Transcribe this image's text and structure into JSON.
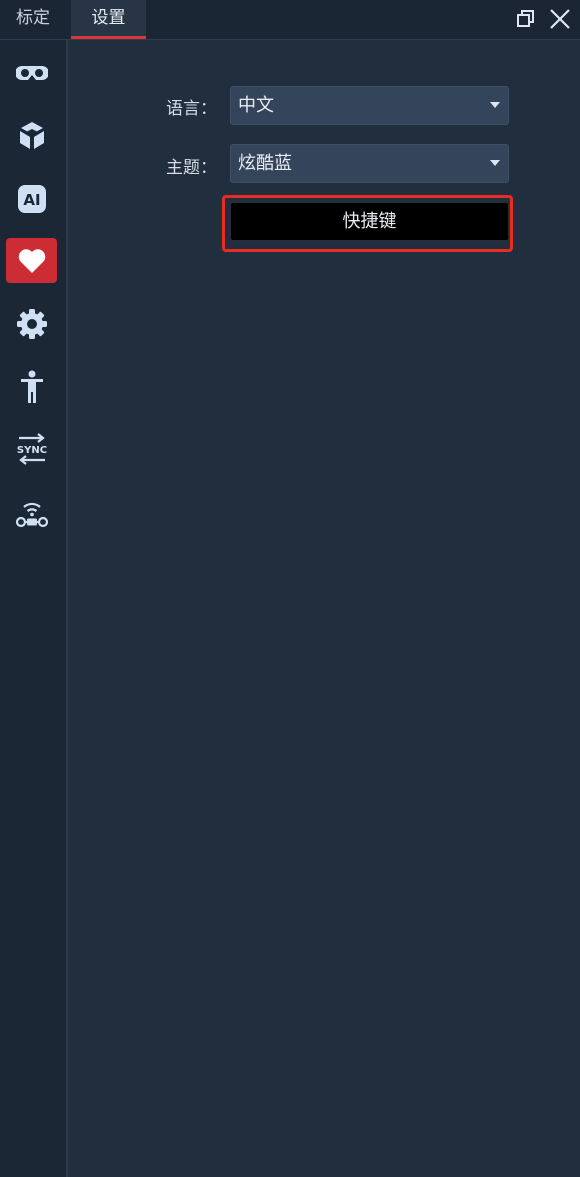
{
  "tabs": [
    {
      "label": "标定",
      "active": false
    },
    {
      "label": "设置",
      "active": true
    }
  ],
  "window_controls": {
    "restore_icon": "restore-window-icon",
    "close_icon": "close-icon"
  },
  "sidebar": {
    "items": [
      {
        "icon": "vr-headset-icon",
        "active": false
      },
      {
        "icon": "cube-drone-icon",
        "active": false
      },
      {
        "icon": "ai-icon",
        "label": "AI",
        "active": false
      },
      {
        "icon": "heart-icon",
        "active": true
      },
      {
        "icon": "gear-icon",
        "active": false
      },
      {
        "icon": "human-figure-icon",
        "active": false
      },
      {
        "icon": "sync-icon",
        "label": "SYNC",
        "active": false
      },
      {
        "icon": "wireless-device-icon",
        "active": false
      }
    ],
    "active_color": "#cc2d35"
  },
  "settings": {
    "language": {
      "label": "语言：",
      "value": "中文"
    },
    "theme": {
      "label": "主题：",
      "value": "炫酷蓝"
    },
    "shortcut_button": "快捷键"
  },
  "colors": {
    "background": "#212e3e",
    "highlight_border": "#ea2b23",
    "tab_underline": "#d9363e"
  }
}
